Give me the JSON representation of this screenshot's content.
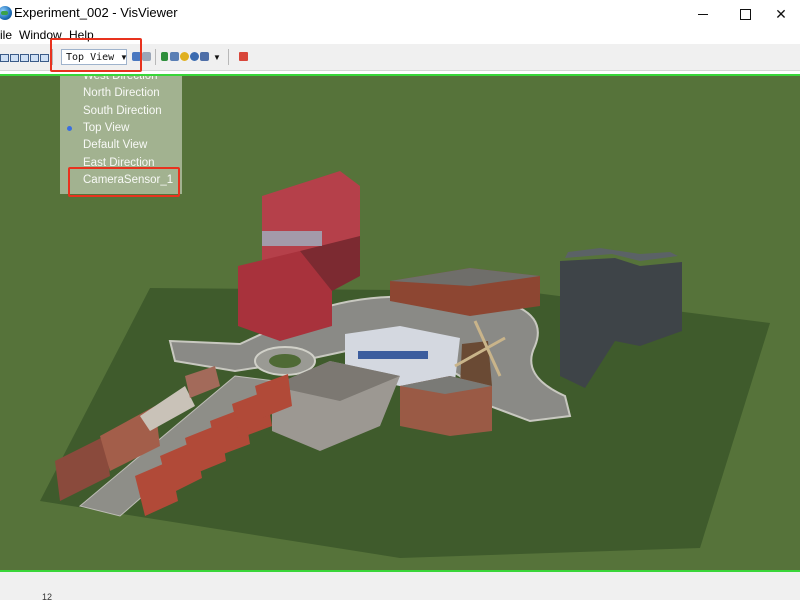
{
  "window": {
    "title": "Experiment_002 - VisViewer",
    "minimize_glyph": "",
    "maximize_glyph": "",
    "close_glyph": "✕"
  },
  "menu": {
    "items": [
      "ile",
      "Window",
      "Help"
    ]
  },
  "toolbar": {
    "view_select_value": "Top View",
    "dropdown_arrow": "▼"
  },
  "view_menu": {
    "items": [
      "West Direction",
      "North Direction",
      "South Direction",
      "Top View",
      "Default View",
      "East Direction",
      "CameraSensor_1"
    ],
    "selected": "Top View"
  },
  "colors": {
    "highlight": "#e8321e",
    "viewport_border": "#39d639",
    "terrain": "#56733a"
  },
  "statusbar": {
    "text": "12"
  }
}
